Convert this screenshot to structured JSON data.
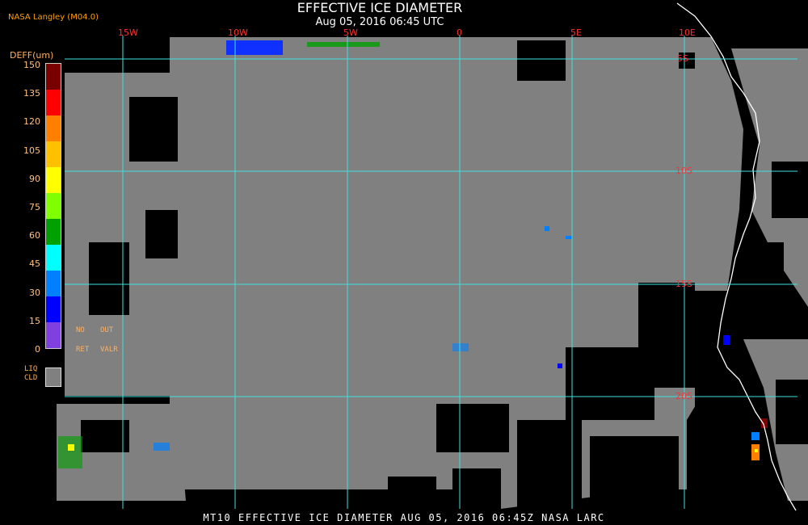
{
  "header": {
    "title": "EFFECTIVE ICE DIAMETER",
    "subtitle": "Aug 05, 2016 06:45 UTC",
    "credit": "NASA Langley (M04.0)"
  },
  "colorbar": {
    "units_label": "DEFF(um)",
    "ticks": [
      "150",
      "135",
      "120",
      "105",
      "90",
      "75",
      "60",
      "45",
      "30",
      "15",
      "0"
    ],
    "colors": [
      "#7a0000",
      "#ff0000",
      "#ff8000",
      "#ffc000",
      "#ffff00",
      "#80ff00",
      "#00a000",
      "#00ffff",
      "#0080ff",
      "#0000ff",
      "#8040e0"
    ],
    "notes": {
      "no": "NO",
      "out": "OUT",
      "ret": "RET",
      "valr": "VALR"
    },
    "liquid_label_1": "LIQ",
    "liquid_label_2": "CLD",
    "liquid_color": "#808080"
  },
  "map": {
    "lon_labels": [
      "15W",
      "10W",
      "5W",
      "0",
      "5E",
      "10E"
    ],
    "lat_labels": [
      "5S",
      "10S",
      "15S",
      "20S"
    ],
    "grid_color": "#40e0e0",
    "cloud_color": "#808080",
    "clear_color": "#000000",
    "coast_color": "#ffffff"
  },
  "footer": {
    "text": "MT10  EFFECTIVE ICE DIAMETER  AUG 05, 2016 06:45Z  NASA LARC"
  }
}
